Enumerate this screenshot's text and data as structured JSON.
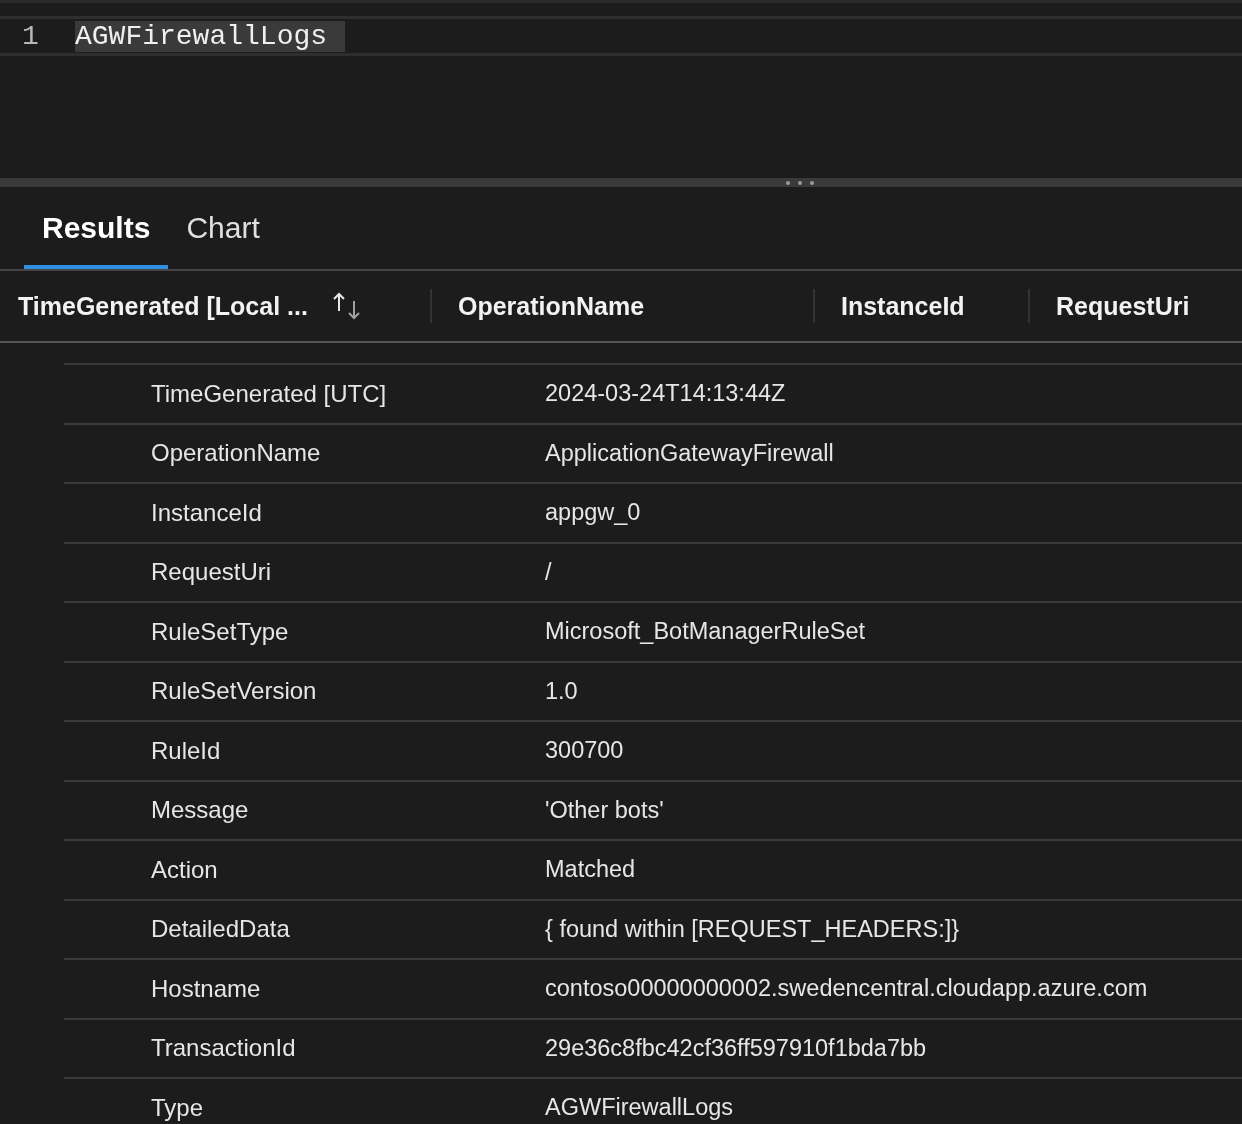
{
  "editor": {
    "lines": [
      {
        "number": "1",
        "code": "AGWFirewallLogs"
      }
    ]
  },
  "tabs": [
    {
      "label": "Results",
      "selected": true
    },
    {
      "label": "Chart",
      "selected": false
    }
  ],
  "table": {
    "columns": [
      {
        "label": "TimeGenerated [Local ...",
        "sortable": true
      },
      {
        "label": "OperationName",
        "sortable": false
      },
      {
        "label": "InstanceId",
        "sortable": false
      },
      {
        "label": "RequestUri",
        "sortable": false
      }
    ]
  },
  "details": [
    {
      "field": "TimeGenerated [UTC]",
      "value": "2024-03-24T14:13:44Z"
    },
    {
      "field": "OperationName",
      "value": "ApplicationGatewayFirewall"
    },
    {
      "field": "InstanceId",
      "value": "appgw_0"
    },
    {
      "field": "RequestUri",
      "value": "/"
    },
    {
      "field": "RuleSetType",
      "value": "Microsoft_BotManagerRuleSet"
    },
    {
      "field": "RuleSetVersion",
      "value": "1.0"
    },
    {
      "field": "RuleId",
      "value": "300700"
    },
    {
      "field": "Message",
      "value": "'Other bots'"
    },
    {
      "field": "Action",
      "value": "Matched"
    },
    {
      "field": "DetailedData",
      "value": "{ found within [REQUEST_HEADERS:]}"
    },
    {
      "field": "Hostname",
      "value": "contoso00000000002.swedencentral.cloudapp.azure.com"
    },
    {
      "field": "TransactionId",
      "value": "29e36c8fbc42cf36ff597910f1bda7bb"
    },
    {
      "field": "Type",
      "value": "AGWFirewallLogs"
    }
  ]
}
